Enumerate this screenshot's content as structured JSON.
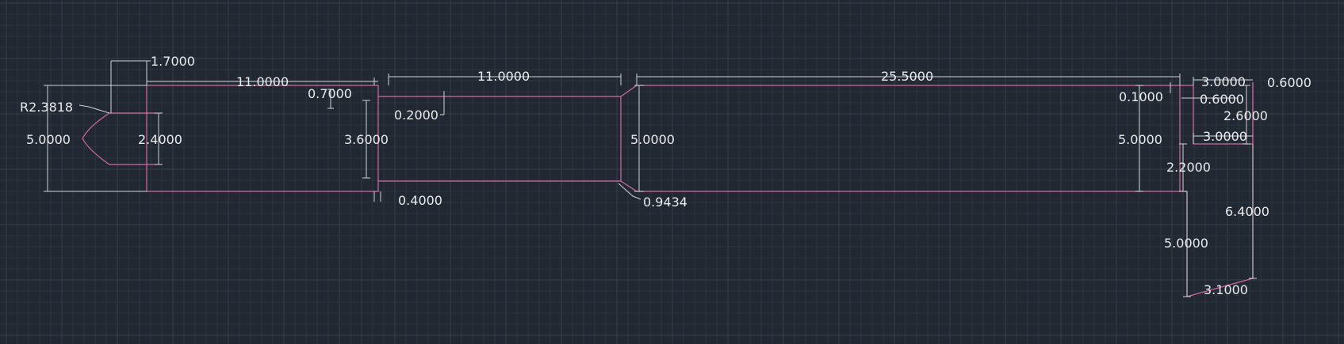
{
  "colors": {
    "background": "#212832",
    "grid": "#343e4b",
    "geometry": "#d06ba4",
    "dimension": "#cfd3d8",
    "text": "#e8eaec"
  },
  "dimensions": {
    "d_1_7": "1.7000",
    "d_11a": "11.0000",
    "d_0_7": "0.7000",
    "d_r": "R2.3818",
    "d_5a": "5.0000",
    "d_2_4": "2.4000",
    "d_11b": "11.0000",
    "d_0_2": "0.2000",
    "d_3_6": "3.6000",
    "d_0_4": "0.4000",
    "d_5b": "5.0000",
    "d_0_9434": "0.9434",
    "d_25_5": "25.5000",
    "d_0_1": "0.1000",
    "d_5c": "5.0000",
    "d_3a": "3.0000",
    "d_0_6a": "0.6000",
    "d_0_6b": "0.6000",
    "d_2_6": "2.6000",
    "d_3b": "3.0000",
    "d_2_2": "2.2000",
    "d_6_4": "6.4000",
    "d_5d": "5.0000",
    "d_3_1": "3.1000"
  }
}
